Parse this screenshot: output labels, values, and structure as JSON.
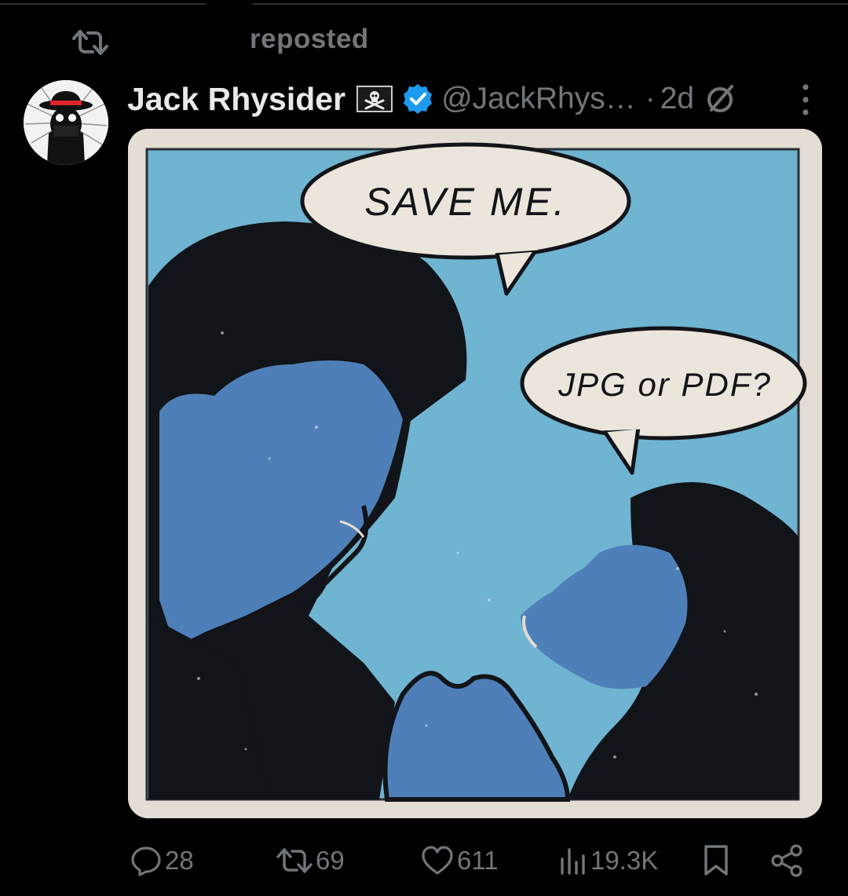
{
  "context": {
    "label": "reposted",
    "icon": "repost-icon"
  },
  "author": {
    "name": "Jack Rhysider",
    "badge_icons": [
      "pirate-flag-icon",
      "verified-badge-icon"
    ],
    "handle": "@JackRhys…",
    "separator": "·",
    "time": "2d"
  },
  "media": {
    "bubble1": "SAVE ME.",
    "bubble2": "JPG or PDF?",
    "colors": {
      "sky": "#6fb4d1",
      "skin": "#4e7fb8",
      "ink": "#111418",
      "frame": "#e3ddd3",
      "bubble": "#ebe5dc"
    }
  },
  "actions": {
    "reply": {
      "icon": "reply-icon",
      "count": "28"
    },
    "repost": {
      "icon": "repost-icon",
      "count": "69"
    },
    "like": {
      "icon": "heart-icon",
      "count": "611"
    },
    "views": {
      "icon": "views-chart-icon",
      "count": "19.3K"
    },
    "bookmark": {
      "icon": "bookmark-icon"
    },
    "share": {
      "icon": "share-icon"
    }
  },
  "colors": {
    "background": "#000000",
    "text": "#e7e9ea",
    "muted": "#71767b",
    "verified": "#1d9bf0"
  }
}
